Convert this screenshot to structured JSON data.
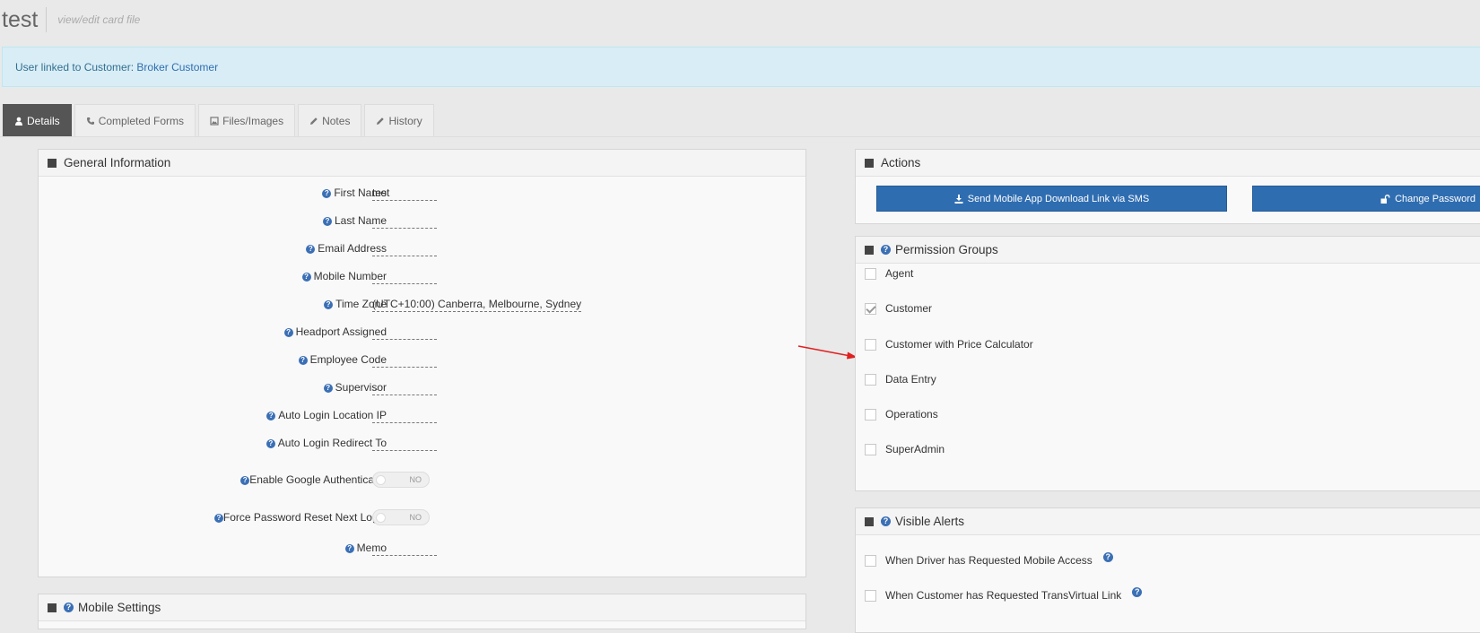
{
  "header": {
    "title": "test",
    "subtitle": "view/edit card file"
  },
  "alert": {
    "prefix": "User linked to Customer:",
    "link": "Broker Customer"
  },
  "tabs": [
    {
      "label": "Details",
      "icon": "user-icon"
    },
    {
      "label": "Completed Forms",
      "icon": "phone-icon"
    },
    {
      "label": "Files/Images",
      "icon": "image-icon"
    },
    {
      "label": "Notes",
      "icon": "pencil-icon"
    },
    {
      "label": "History",
      "icon": "pencil-icon"
    }
  ],
  "general": {
    "title": "General Information",
    "fields": [
      {
        "label": "First Name",
        "value": "test"
      },
      {
        "label": "Last Name",
        "value": ""
      },
      {
        "label": "Email Address",
        "value": ""
      },
      {
        "label": "Mobile Number",
        "value": ""
      },
      {
        "label": "Time Zone",
        "value": "(UTC+10:00) Canberra, Melbourne, Sydney"
      },
      {
        "label": "Headport Assigned",
        "value": "..."
      },
      {
        "label": "Employee Code",
        "value": ""
      },
      {
        "label": "Supervisor",
        "value": "..."
      },
      {
        "label": "Auto Login Location IP",
        "value": ""
      },
      {
        "label": "Auto Login Redirect To",
        "value": ""
      },
      {
        "label": "Enable Google Authenticator",
        "toggle": "NO"
      },
      {
        "label": "Force Password Reset Next Login",
        "toggle": "NO"
      },
      {
        "label": "Memo",
        "value": ""
      }
    ]
  },
  "mobile": {
    "title": "Mobile Settings"
  },
  "actions": {
    "title": "Actions",
    "sms_button": "Send Mobile App Download Link via SMS",
    "password_button": "Change Password"
  },
  "permissions": {
    "title": "Permission Groups",
    "items": [
      {
        "label": "Agent",
        "checked": false
      },
      {
        "label": "Customer",
        "checked": true
      },
      {
        "label": "Customer with Price Calculator",
        "checked": false
      },
      {
        "label": "Data Entry",
        "checked": false
      },
      {
        "label": "Operations",
        "checked": false
      },
      {
        "label": "SuperAdmin",
        "checked": false
      }
    ]
  },
  "visible_alerts": {
    "title": "Visible Alerts",
    "items": [
      {
        "label": "When Driver has Requested Mobile Access",
        "checked": false
      },
      {
        "label": "When Customer has Requested TransVirtual Link",
        "checked": false
      }
    ]
  },
  "colors": {
    "primary": "#2f6db1",
    "alert_bg": "#d9edf7",
    "active_tab": "#555555",
    "arrow": "#e02020"
  }
}
